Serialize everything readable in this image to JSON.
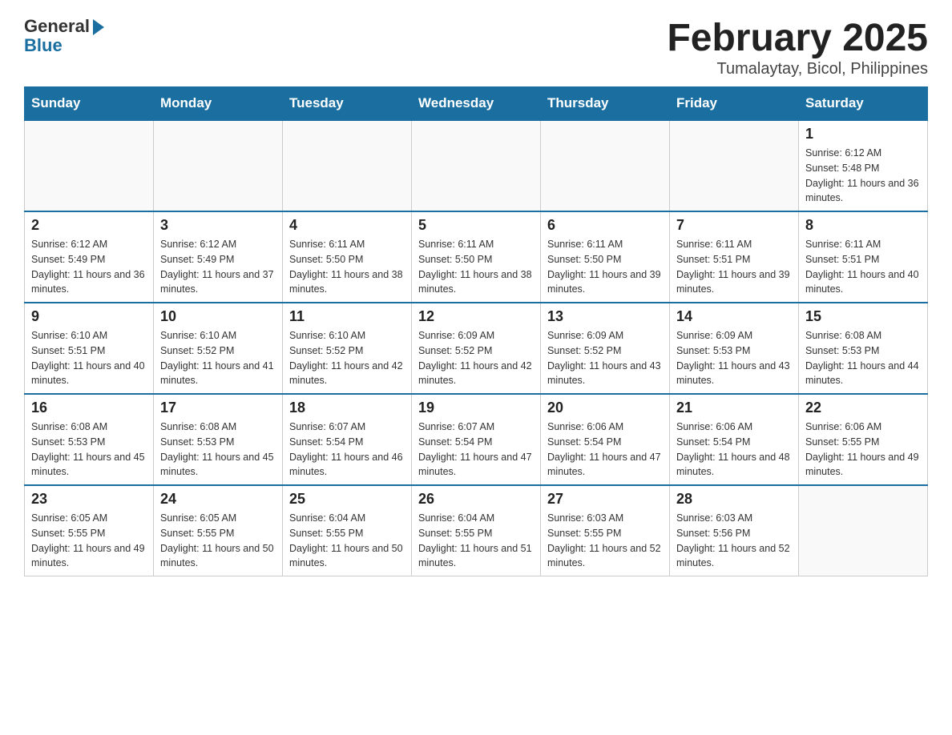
{
  "header": {
    "logo_general": "General",
    "logo_blue": "Blue",
    "month_title": "February 2025",
    "location": "Tumalaytay, Bicol, Philippines"
  },
  "weekdays": [
    "Sunday",
    "Monday",
    "Tuesday",
    "Wednesday",
    "Thursday",
    "Friday",
    "Saturday"
  ],
  "weeks": [
    [
      {
        "day": "",
        "info": ""
      },
      {
        "day": "",
        "info": ""
      },
      {
        "day": "",
        "info": ""
      },
      {
        "day": "",
        "info": ""
      },
      {
        "day": "",
        "info": ""
      },
      {
        "day": "",
        "info": ""
      },
      {
        "day": "1",
        "info": "Sunrise: 6:12 AM\nSunset: 5:48 PM\nDaylight: 11 hours and 36 minutes."
      }
    ],
    [
      {
        "day": "2",
        "info": "Sunrise: 6:12 AM\nSunset: 5:49 PM\nDaylight: 11 hours and 36 minutes."
      },
      {
        "day": "3",
        "info": "Sunrise: 6:12 AM\nSunset: 5:49 PM\nDaylight: 11 hours and 37 minutes."
      },
      {
        "day": "4",
        "info": "Sunrise: 6:11 AM\nSunset: 5:50 PM\nDaylight: 11 hours and 38 minutes."
      },
      {
        "day": "5",
        "info": "Sunrise: 6:11 AM\nSunset: 5:50 PM\nDaylight: 11 hours and 38 minutes."
      },
      {
        "day": "6",
        "info": "Sunrise: 6:11 AM\nSunset: 5:50 PM\nDaylight: 11 hours and 39 minutes."
      },
      {
        "day": "7",
        "info": "Sunrise: 6:11 AM\nSunset: 5:51 PM\nDaylight: 11 hours and 39 minutes."
      },
      {
        "day": "8",
        "info": "Sunrise: 6:11 AM\nSunset: 5:51 PM\nDaylight: 11 hours and 40 minutes."
      }
    ],
    [
      {
        "day": "9",
        "info": "Sunrise: 6:10 AM\nSunset: 5:51 PM\nDaylight: 11 hours and 40 minutes."
      },
      {
        "day": "10",
        "info": "Sunrise: 6:10 AM\nSunset: 5:52 PM\nDaylight: 11 hours and 41 minutes."
      },
      {
        "day": "11",
        "info": "Sunrise: 6:10 AM\nSunset: 5:52 PM\nDaylight: 11 hours and 42 minutes."
      },
      {
        "day": "12",
        "info": "Sunrise: 6:09 AM\nSunset: 5:52 PM\nDaylight: 11 hours and 42 minutes."
      },
      {
        "day": "13",
        "info": "Sunrise: 6:09 AM\nSunset: 5:52 PM\nDaylight: 11 hours and 43 minutes."
      },
      {
        "day": "14",
        "info": "Sunrise: 6:09 AM\nSunset: 5:53 PM\nDaylight: 11 hours and 43 minutes."
      },
      {
        "day": "15",
        "info": "Sunrise: 6:08 AM\nSunset: 5:53 PM\nDaylight: 11 hours and 44 minutes."
      }
    ],
    [
      {
        "day": "16",
        "info": "Sunrise: 6:08 AM\nSunset: 5:53 PM\nDaylight: 11 hours and 45 minutes."
      },
      {
        "day": "17",
        "info": "Sunrise: 6:08 AM\nSunset: 5:53 PM\nDaylight: 11 hours and 45 minutes."
      },
      {
        "day": "18",
        "info": "Sunrise: 6:07 AM\nSunset: 5:54 PM\nDaylight: 11 hours and 46 minutes."
      },
      {
        "day": "19",
        "info": "Sunrise: 6:07 AM\nSunset: 5:54 PM\nDaylight: 11 hours and 47 minutes."
      },
      {
        "day": "20",
        "info": "Sunrise: 6:06 AM\nSunset: 5:54 PM\nDaylight: 11 hours and 47 minutes."
      },
      {
        "day": "21",
        "info": "Sunrise: 6:06 AM\nSunset: 5:54 PM\nDaylight: 11 hours and 48 minutes."
      },
      {
        "day": "22",
        "info": "Sunrise: 6:06 AM\nSunset: 5:55 PM\nDaylight: 11 hours and 49 minutes."
      }
    ],
    [
      {
        "day": "23",
        "info": "Sunrise: 6:05 AM\nSunset: 5:55 PM\nDaylight: 11 hours and 49 minutes."
      },
      {
        "day": "24",
        "info": "Sunrise: 6:05 AM\nSunset: 5:55 PM\nDaylight: 11 hours and 50 minutes."
      },
      {
        "day": "25",
        "info": "Sunrise: 6:04 AM\nSunset: 5:55 PM\nDaylight: 11 hours and 50 minutes."
      },
      {
        "day": "26",
        "info": "Sunrise: 6:04 AM\nSunset: 5:55 PM\nDaylight: 11 hours and 51 minutes."
      },
      {
        "day": "27",
        "info": "Sunrise: 6:03 AM\nSunset: 5:55 PM\nDaylight: 11 hours and 52 minutes."
      },
      {
        "day": "28",
        "info": "Sunrise: 6:03 AM\nSunset: 5:56 PM\nDaylight: 11 hours and 52 minutes."
      },
      {
        "day": "",
        "info": ""
      }
    ]
  ]
}
